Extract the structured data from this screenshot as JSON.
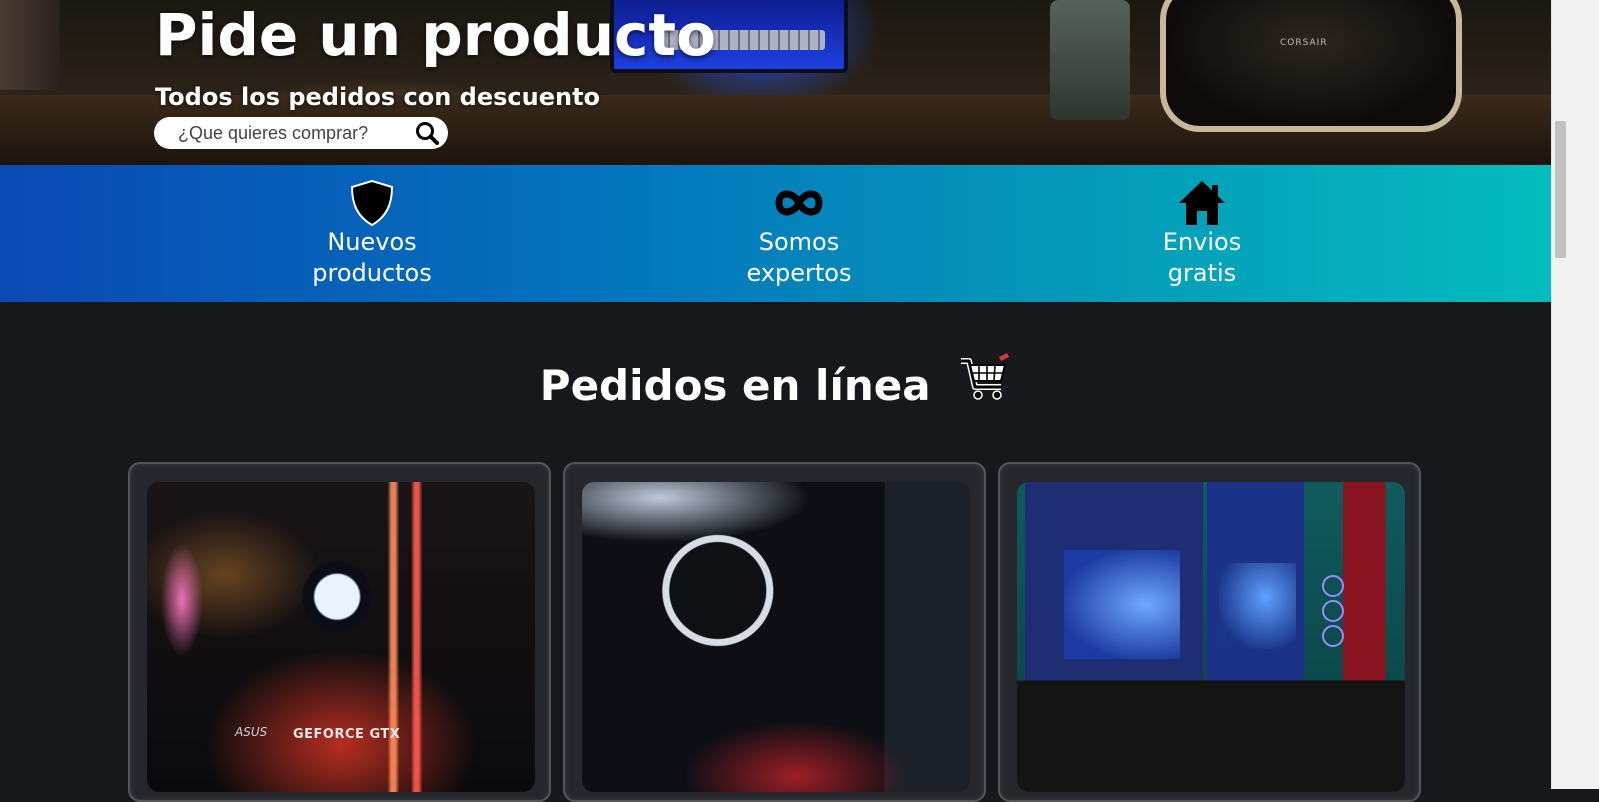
{
  "hero": {
    "title": "Pide un producto",
    "subtitle": "Todos los pedidos con descuento",
    "background_brand_text": "CORSAIR",
    "search": {
      "placeholder": "¿Que quieres comprar?",
      "value": "",
      "icon": "search-icon"
    }
  },
  "features": [
    {
      "icon": "shield-icon",
      "line1": "Nuevos",
      "line2": "productos"
    },
    {
      "icon": "infinity-icon",
      "line1": "Somos",
      "line2": "expertos"
    },
    {
      "icon": "house-icon",
      "line1": "Envios",
      "line2": "gratis"
    }
  ],
  "section": {
    "title": "Pedidos en línea",
    "icon": "shopping-cart-icon"
  },
  "cards": [
    {
      "image": "pc-build-asus-geforce",
      "image_text": "GEFORCE GTX",
      "image_brand": "ASUS"
    },
    {
      "image": "pc-build-corsair-cooler",
      "image_text": ""
    },
    {
      "image": "gaming-desk-setup",
      "image_text": ""
    }
  ],
  "colors": {
    "band_start": "#0a49b3",
    "band_end": "#03bcbd",
    "page_bg": "#17181c",
    "card_border": "#55565c"
  }
}
